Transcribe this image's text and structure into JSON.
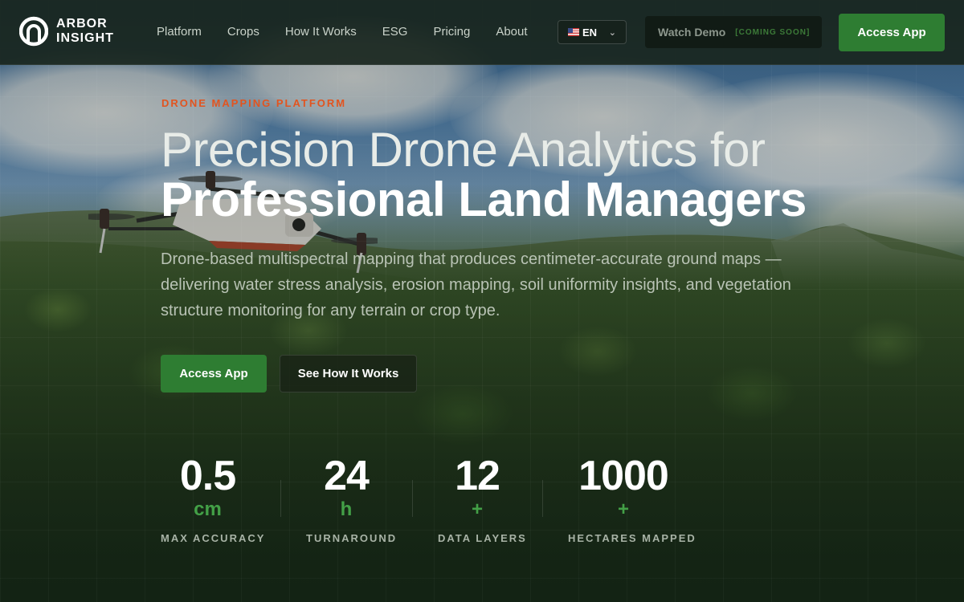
{
  "brand": {
    "line1": "ARBOR",
    "line2": "INSIGHT"
  },
  "nav": {
    "links": [
      "Platform",
      "Crops",
      "How It Works",
      "ESG",
      "Pricing",
      "About"
    ],
    "language": {
      "selected": "EN",
      "flag": "US flag"
    },
    "watch_demo": {
      "label": "Watch Demo",
      "tag": "[COMING SOON]"
    },
    "cta": "Access App"
  },
  "hero": {
    "eyebrow": "DRONE MAPPING PLATFORM",
    "title_light": "Precision Drone Analytics for",
    "title_bold": "Professional Land Managers",
    "lede": "Drone-based multispectral mapping that produces centimeter-accurate ground maps — delivering water stress analysis, erosion mapping, soil uniformity insights, and vegetation structure monitoring for any terrain or crop type.",
    "primary_cta": "Access App",
    "secondary_cta": "See How It Works"
  },
  "stats": [
    {
      "value": "0.5",
      "unit": "cm",
      "label": "MAX ACCURACY"
    },
    {
      "value": "24",
      "unit": "h",
      "label": "TURNAROUND"
    },
    {
      "value": "12",
      "unit": "+",
      "label": "DATA LAYERS"
    },
    {
      "value": "1000",
      "unit": "+",
      "label": "HECTARES MAPPED"
    }
  ],
  "colors": {
    "accent_green": "#2e7d32",
    "stat_unit_green": "#43a047",
    "eyebrow_orange": "#e2541f",
    "nav_bg": "#19261e"
  }
}
